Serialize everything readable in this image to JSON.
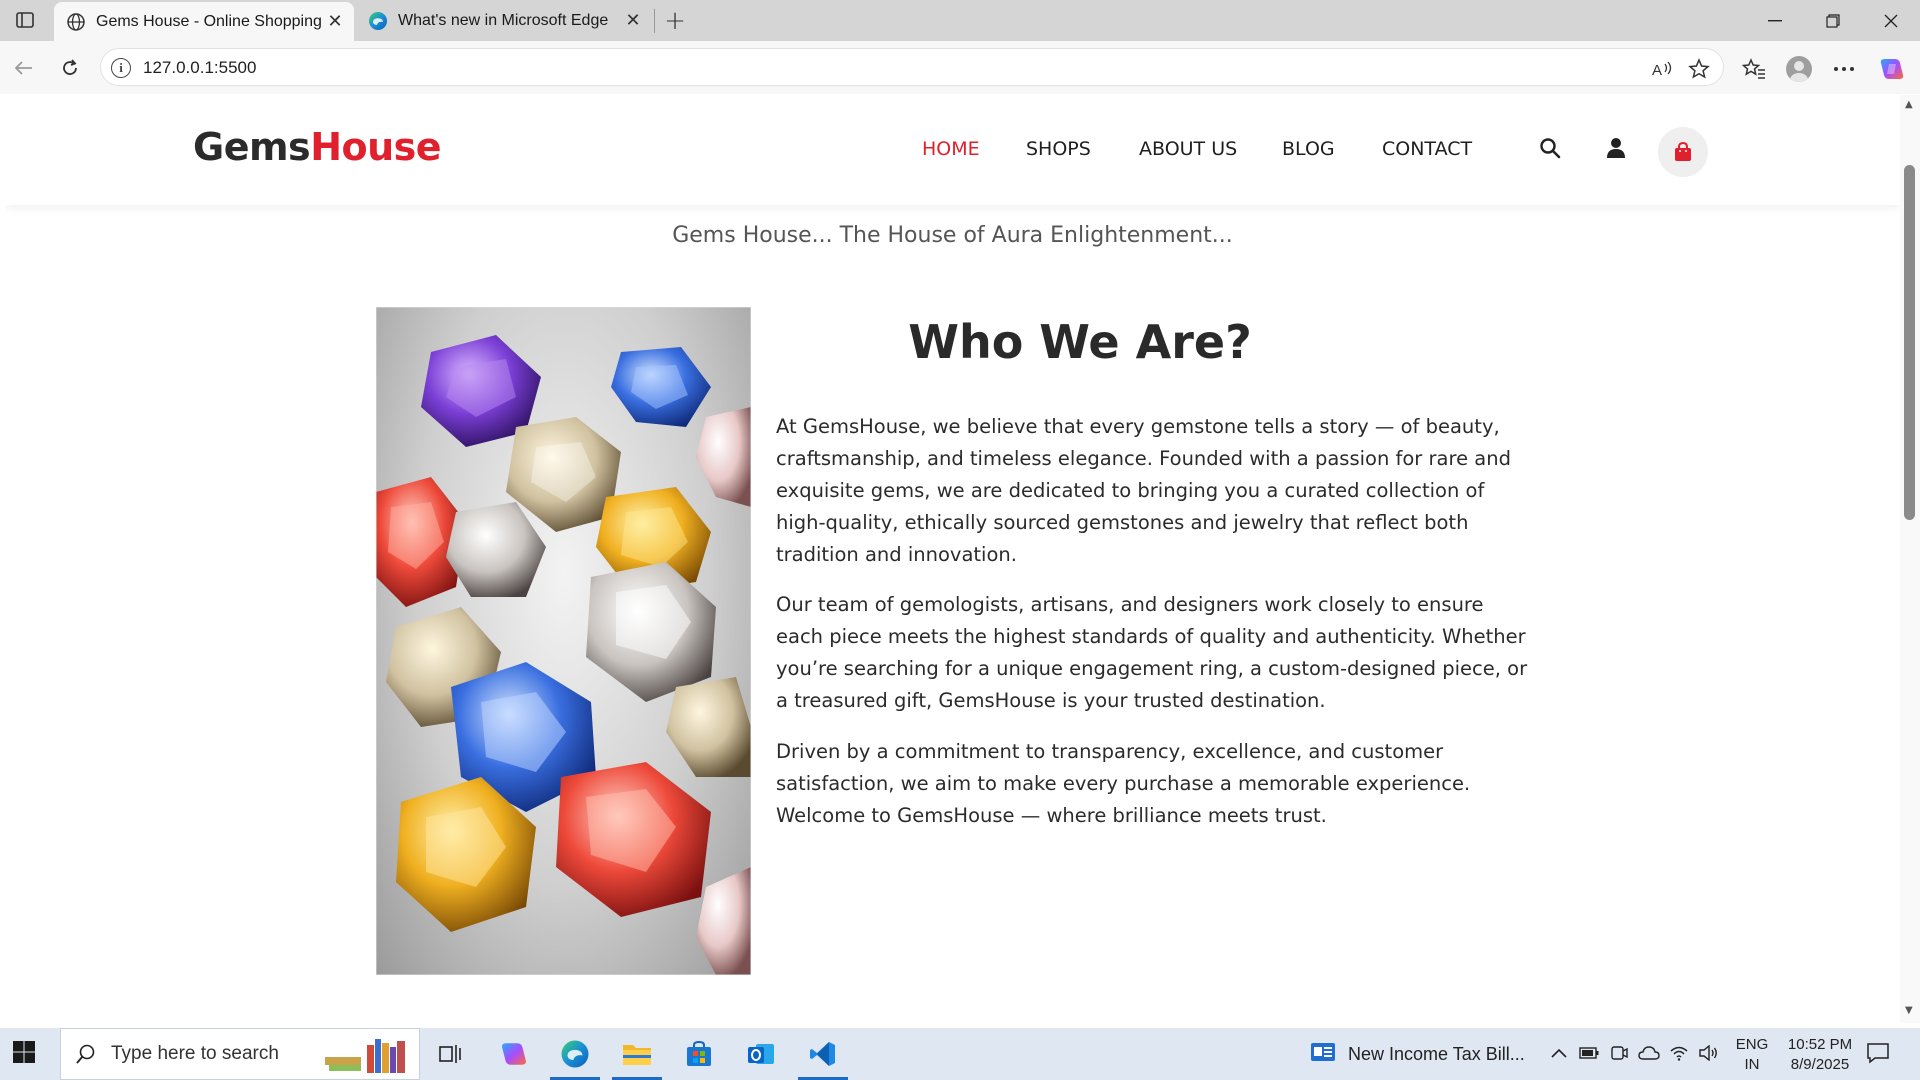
{
  "browser": {
    "tabs": [
      {
        "title": "Gems House - Online Shopping W",
        "active": true
      },
      {
        "title": "What's new in Microsoft Edge",
        "active": false
      }
    ],
    "url": "127.0.0.1:5500"
  },
  "site": {
    "logo_part1": "Gems",
    "logo_part2": "House",
    "nav": [
      "HOME",
      "SHOPS",
      "ABOUT US",
      "BLOG",
      "CONTACT"
    ],
    "active_nav": "HOME",
    "tagline": "Gems House... The House of Aura Enlightenment...",
    "about": {
      "title": "Who We Are?",
      "paragraphs": [
        "At GemsHouse, we believe that every gemstone tells a story — of beauty, craftsmanship, and timeless elegance. Founded with a passion for rare and exquisite gems, we are dedicated to bringing you a curated collection of high-quality, ethically sourced gemstones and jewelry that reflect both tradition and innovation.",
        "Our team of gemologists, artisans, and designers work closely to ensure each piece meets the highest standards of quality and authenticity. Whether you’re searching for a unique engagement ring, a custom-designed piece, or a treasured gift, GemsHouse is your trusted destination.",
        "Driven by a commitment to transparency, excellence, and customer satisfaction, we aim to make every purchase a memorable experience. Welcome to GemsHouse — where brilliance meets trust."
      ]
    }
  },
  "colors": {
    "brand_red": "#e0202c",
    "text_dark": "#2b2b2b"
  },
  "taskbar": {
    "search_placeholder": "Type here to search",
    "news": "New Income Tax Bill...",
    "lang_line1": "ENG",
    "lang_line2": "IN",
    "time": "10:52 PM",
    "date": "8/9/2025"
  }
}
